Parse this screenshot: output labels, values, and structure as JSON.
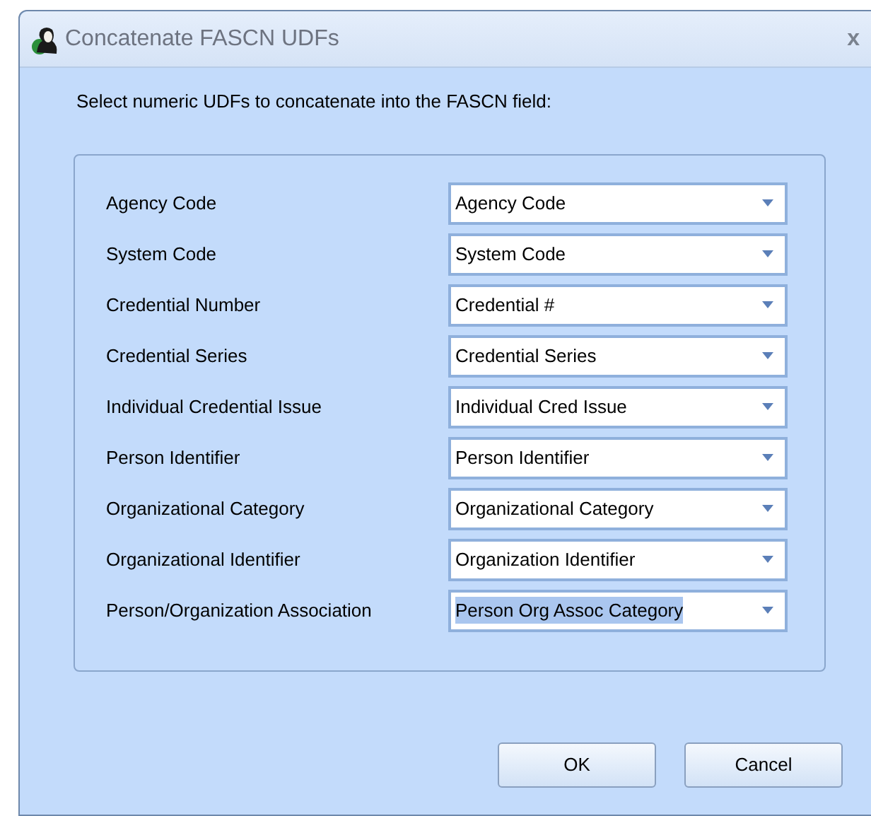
{
  "window": {
    "title": "Concatenate FASCN UDFs",
    "close": "x"
  },
  "instruction": "Select numeric UDFs to concatenate into the FASCN field:",
  "fields": [
    {
      "label": "Agency Code",
      "value": "Agency Code",
      "highlighted": false
    },
    {
      "label": "System Code",
      "value": "System Code",
      "highlighted": false
    },
    {
      "label": "Credential Number",
      "value": "Credential #",
      "highlighted": false
    },
    {
      "label": "Credential Series",
      "value": "Credential Series",
      "highlighted": false
    },
    {
      "label": "Individual Credential Issue",
      "value": "Individual Cred Issue",
      "highlighted": false
    },
    {
      "label": "Person Identifier",
      "value": "Person Identifier",
      "highlighted": false
    },
    {
      "label": "Organizational Category",
      "value": "Organizational Category",
      "highlighted": false
    },
    {
      "label": "Organizational Identifier",
      "value": "Organization Identifier",
      "highlighted": false
    },
    {
      "label": "Person/Organization Association",
      "value": "Person Org Assoc Category",
      "highlighted": true
    }
  ],
  "buttons": [
    "OK",
    "Cancel"
  ]
}
